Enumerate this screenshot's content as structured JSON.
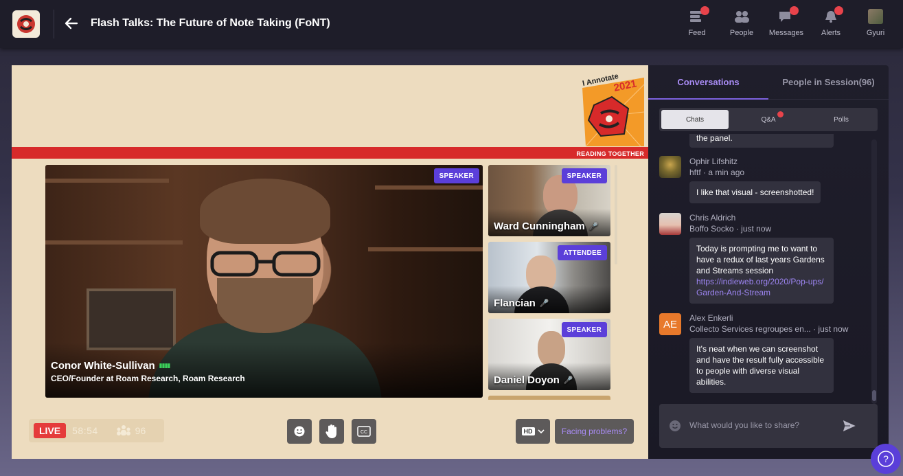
{
  "header": {
    "title": "Flash Talks: The Future of Note Taking (FoNT)",
    "nav": [
      {
        "label": "Feed",
        "icon": "feed-icon",
        "dot": true
      },
      {
        "label": "People",
        "icon": "people-icon",
        "dot": false
      },
      {
        "label": "Messages",
        "icon": "messages-icon",
        "dot": true
      },
      {
        "label": "Alerts",
        "icon": "bell-icon",
        "dot": true
      },
      {
        "label": "Gyuri",
        "icon": "user-avatar",
        "dot": false
      }
    ]
  },
  "stage": {
    "banner": {
      "logo_line1": "I Annotate",
      "logo_year": "2021",
      "tagline": "READING TOGETHER"
    },
    "main_speaker": {
      "name": "Conor White-Sullivan",
      "role": "CEO/Founder at Roam Research, Roam Research",
      "badge": "SPEAKER"
    },
    "tiles": [
      {
        "name": "Ward Cunningham",
        "badge": "SPEAKER",
        "muted": true
      },
      {
        "name": "Flancian",
        "badge": "ATTENDEE",
        "muted": true
      },
      {
        "name": "Daniel Doyon",
        "badge": "SPEAKER",
        "muted": true
      }
    ],
    "controls": {
      "live_label": "LIVE",
      "elapsed": "58:54",
      "attendee_count": "96",
      "hd_label": "HD",
      "facing_problems": "Facing problems?"
    }
  },
  "sidebar": {
    "tabs": {
      "conversations": "Conversations",
      "people": "People in Session(96)"
    },
    "segments": {
      "chats": "Chats",
      "qa": "Q&A",
      "polls": "Polls"
    },
    "messages": [
      {
        "partial_text": "the panel."
      },
      {
        "author": "Ophir Lifshitz",
        "meta": "hftf · a min ago",
        "text": "I like that visual - screenshotted!"
      },
      {
        "author": "Chris Aldrich",
        "meta": "Boffo Socko · just now",
        "text": "Today is prompting me to want to have a redux of last years Gardens and Streams session",
        "link": "https://indieweb.org/2020/Pop-ups/Garden-And-Stream"
      },
      {
        "author": "Alex Enkerli",
        "initials": "AE",
        "meta": "Collecto Services regroupes en... · just now",
        "text": "It's neat when we can screenshot and have the result fully accessible to people with diverse visual abilities."
      }
    ],
    "compose": {
      "placeholder": "What would you like to share?"
    }
  },
  "help": {
    "label": "?"
  },
  "colors": {
    "accent": "#5b3fd9",
    "live": "#e53b3b",
    "notify": "#e8434b",
    "stage_bg": "#eddcbf"
  }
}
